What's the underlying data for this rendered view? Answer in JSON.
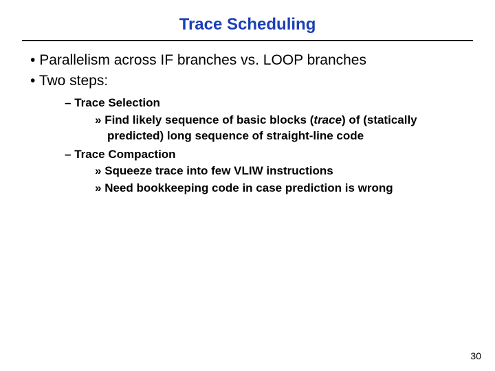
{
  "title": "Trace Scheduling",
  "colors": {
    "title": "#1a3fb5"
  },
  "bullets": {
    "l1": [
      "Parallelism across IF branches vs. LOOP branches",
      "Two steps:"
    ],
    "l2a": "Trace Selection",
    "l2a_sub": {
      "pre": "Find likely sequence of basic blocks (",
      "em": "trace",
      "post": ") of (statically predicted) long sequence of straight-line code"
    },
    "l2b": "Trace Compaction",
    "l2b_sub1": "Squeeze trace into few VLIW instructions",
    "l2b_sub2": "Need bookkeeping code in case prediction is wrong"
  },
  "page_number": "30"
}
